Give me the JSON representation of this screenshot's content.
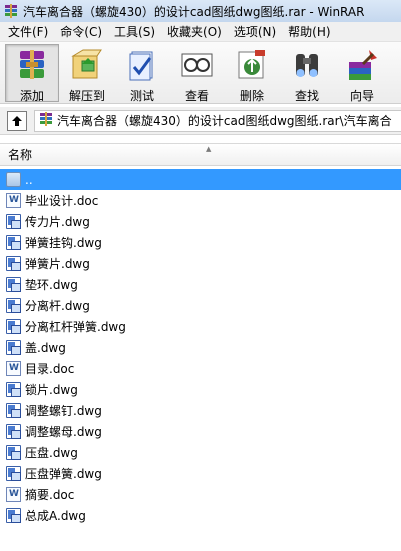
{
  "window": {
    "title": "汽车离合器（螺旋430）的设计cad图纸dwg图纸.rar - WinRAR"
  },
  "menu": [
    {
      "label": "文件(F)"
    },
    {
      "label": "命令(C)"
    },
    {
      "label": "工具(S)"
    },
    {
      "label": "收藏夹(O)"
    },
    {
      "label": "选项(N)"
    },
    {
      "label": "帮助(H)"
    }
  ],
  "toolbar": [
    {
      "label": "添加",
      "icon": "add-icon"
    },
    {
      "label": "解压到",
      "icon": "extract-icon"
    },
    {
      "label": "测试",
      "icon": "test-icon"
    },
    {
      "label": "查看",
      "icon": "view-icon"
    },
    {
      "label": "删除",
      "icon": "delete-icon"
    },
    {
      "label": "查找",
      "icon": "find-icon"
    },
    {
      "label": "向导",
      "icon": "wizard-icon"
    }
  ],
  "address": {
    "path": "汽车离合器（螺旋430）的设计cad图纸dwg图纸.rar\\汽车离合"
  },
  "list": {
    "column_name": "名称",
    "items": [
      {
        "name": "..",
        "type": "parent"
      },
      {
        "name": "毕业设计.doc",
        "type": "doc"
      },
      {
        "name": "传力片.dwg",
        "type": "dwg"
      },
      {
        "name": "弹簧挂钩.dwg",
        "type": "dwg"
      },
      {
        "name": "弹簧片.dwg",
        "type": "dwg"
      },
      {
        "name": "垫环.dwg",
        "type": "dwg"
      },
      {
        "name": "分离杆.dwg",
        "type": "dwg"
      },
      {
        "name": "分离杠杆弹簧.dwg",
        "type": "dwg"
      },
      {
        "name": "盖.dwg",
        "type": "dwg"
      },
      {
        "name": "目录.doc",
        "type": "doc"
      },
      {
        "name": "锁片.dwg",
        "type": "dwg"
      },
      {
        "name": "调整螺钉.dwg",
        "type": "dwg"
      },
      {
        "name": "调整螺母.dwg",
        "type": "dwg"
      },
      {
        "name": "压盘.dwg",
        "type": "dwg"
      },
      {
        "name": "压盘弹簧.dwg",
        "type": "dwg"
      },
      {
        "name": "摘要.doc",
        "type": "doc"
      },
      {
        "name": "总成A.dwg",
        "type": "dwg"
      }
    ]
  }
}
